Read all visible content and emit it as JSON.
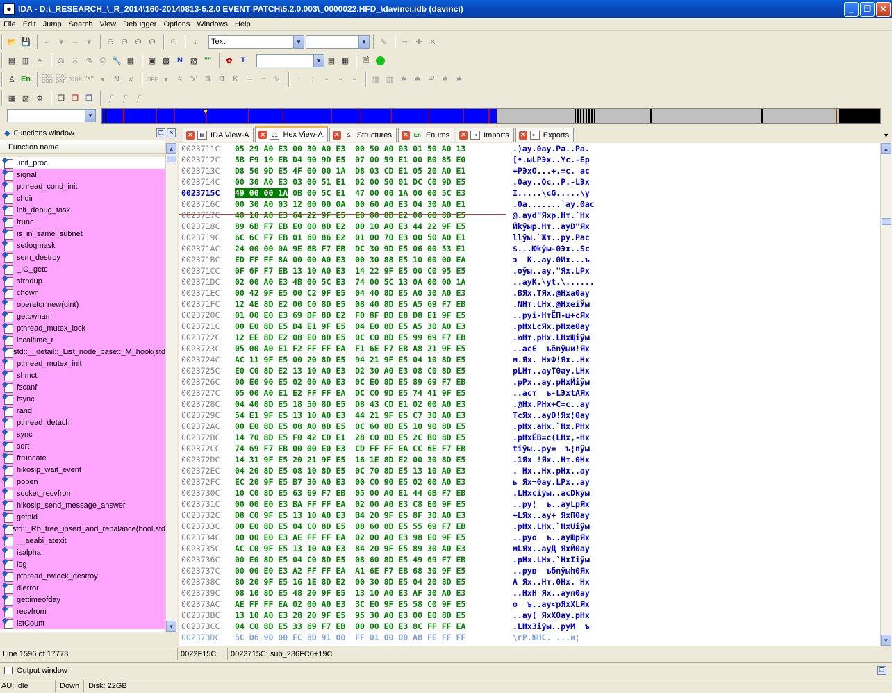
{
  "window": {
    "title": "IDA - D:\\_RESEARCH_\\_R_2014\\160-20140813-5.2.0 EVENT PATCH\\5.2.0.003\\_0000022.HFD_\\davinci.idb (davinci)"
  },
  "menu": [
    "File",
    "Edit",
    "Jump",
    "Search",
    "View",
    "Debugger",
    "Options",
    "Windows",
    "Help"
  ],
  "toolbar": {
    "type_combo": "Text",
    "second_combo": "",
    "third_combo": "",
    "nav_combo": ""
  },
  "functions_window": {
    "title": "Functions window",
    "column": "Function name",
    "items": [
      ".init_proc",
      "signal",
      "pthread_cond_init",
      "chdir",
      "init_debug_task",
      "trunc",
      "is_in_same_subnet",
      "setlogmask",
      "sem_destroy",
      "_IO_getc",
      "strndup",
      "chown",
      "operator new(uint)",
      "getpwnam",
      "pthread_mutex_lock",
      "localtime_r",
      "std::__detail::_List_node_base::_M_hook(std",
      "pthread_mutex_init",
      "shmctl",
      "fscanf",
      "fsync",
      "rand",
      "pthread_detach",
      "sync",
      "sqrt",
      "ftruncate",
      "hikosip_wait_event",
      "popen",
      "socket_recvfrom",
      "hikosip_send_message_answer",
      "getpid",
      "std::_Rb_tree_insert_and_rebalance(bool,std",
      "__aeabi_atexit",
      "isalpha",
      "log",
      "pthread_rwlock_destroy",
      "dlerror",
      "gettimeofday",
      "recvfrom",
      "lstCount"
    ]
  },
  "tabs": [
    {
      "label": "IDA View-A",
      "icon": "ida-view-icon"
    },
    {
      "label": "Hex View-A",
      "icon": "hex-view-icon",
      "active": true
    },
    {
      "label": "Structures",
      "icon": "structures-icon"
    },
    {
      "label": "Enums",
      "icon": "enums-icon",
      "prefix": "En"
    },
    {
      "label": "Imports",
      "icon": "imports-icon"
    },
    {
      "label": "Exports",
      "icon": "exports-icon"
    }
  ],
  "hex": {
    "rows": [
      {
        "addr": "0023711C",
        "hex": "05 29 A0 E3 00 30 A0 E3  00 50 A0 03 01 50 A0 13",
        "asc": ".)ay.0ay.Pa..Pa."
      },
      {
        "addr": "0023712C",
        "hex": "5B F9 19 EB D4 90 9D E5  07 00 59 E1 00 B0 85 E0",
        "asc": "[•.ыLPЭх..Yc.-Ер"
      },
      {
        "addr": "0023713C",
        "hex": "D8 50 9D E5 4F 00 00 1A  D8 03 CD E1 05 20 A0 E1",
        "asc": "+PЭхO...+.=c. ac"
      },
      {
        "addr": "0023714C",
        "hex": "00 30 A0 E3 03 00 51 E1  02 00 50 01 DC C0 9D E5",
        "asc": ".0ay..Qc..P.-LЭх"
      },
      {
        "addr": "0023715C",
        "hex": "49 00 00 1A 0B 00 5C E1  47 00 00 1A 00 00 5C E3",
        "asc": "I.....\\cG.....\\y",
        "current": true,
        "hl": "49 00 00 1A",
        "rest": " 0B 00 5C E1  47 00 00 1A 00 00 5C E3"
      },
      {
        "addr": "0023716C",
        "hex": "00 30 A0 03 12 00 00 0A  00 60 A0 E3 04 30 A0 E1",
        "asc": ".0a.......`ay.0ac"
      },
      {
        "addr": "0023717C",
        "hex": "40 10 A0 E3 64 22 9F E5  E0 00 8D E2 00 60 8D E5",
        "asc": "@.ayd\"Яхр.Нт.`Нх"
      },
      {
        "addr": "0023718C",
        "hex": "89 6B F7 EB E0 00 8D E2  00 10 A0 E3 44 22 9F E5",
        "asc": "Йkўыр.Нт..ayD\"Ях"
      },
      {
        "addr": "0023719C",
        "hex": "6C 6C F7 EB 01 60 86 E2  01 00 70 E3 00 50 A0 E1",
        "asc": "llўы.`Жт..py.Pac"
      },
      {
        "addr": "002371AC",
        "hex": "24 00 00 0A 9E 6B F7 EB  DC 30 9D E5 06 00 53 E1",
        "asc": "$...Юkўы-0Эх..Sc"
      },
      {
        "addr": "002371BC",
        "hex": "ED FF FF 8A 00 00 A0 E3  00 30 88 E5 10 00 00 EA",
        "asc": "э  К..ay.0Их...ъ"
      },
      {
        "addr": "002371CC",
        "hex": "0F 6F F7 EB 13 10 A0 E3  14 22 9F E5 00 C0 95 E5",
        "asc": ".oўы..ay.\"Ях.LРх"
      },
      {
        "addr": "002371DC",
        "hex": "02 00 A0 E3 4B 00 5C E3  74 00 5C 13 0A 00 00 1A",
        "asc": "..ayK.\\yt.\\......"
      },
      {
        "addr": "002371EC",
        "hex": "00 42 9F E5 00 C2 9F E5  04 40 8D E5 A0 30 A0 E3",
        "asc": ".BЯх.TЯх.@Нха0ay"
      },
      {
        "addr": "002371FC",
        "hex": "12 4E 8D E2 00 C0 8D E5  08 40 8D E5 A5 69 F7 EB",
        "asc": ".NНт.LНх.@НхеiЎы"
      },
      {
        "addr": "0023720C",
        "hex": "01 00 E0 E3 69 DF 8D E2  F0 8F BD E8 D8 E1 9F E5",
        "asc": "..pyi-НтЁП-ш+сЯх"
      },
      {
        "addr": "0023721C",
        "hex": "00 E0 8D E5 D4 E1 9F E5  04 E0 8D E5 A5 30 A0 E3",
        "asc": ".pНхLсЯх.pНхе0ay"
      },
      {
        "addr": "0023722C",
        "hex": "12 EE 8D E2 08 E0 8D E5  0C C0 8D E5 99 69 F7 EB",
        "asc": ".юНт.pНх.LНхЩiўы"
      },
      {
        "addr": "0023723C",
        "hex": "05 00 A0 E1 F2 FF FF EA  F1 6E F7 EB A8 21 9F E5",
        "asc": "..acЄ  ъёnўыи!Ях"
      },
      {
        "addr": "0023724C",
        "hex": "AC 11 9F E5 00 20 8D E5  94 21 9F E5 04 10 8D E5",
        "asc": "м.Ях. НхФ!Ях..Нх"
      },
      {
        "addr": "0023725C",
        "hex": "E0 C0 8D E2 13 10 A0 E3  D2 30 A0 E3 08 C0 8D E5",
        "asc": "pLНт..ayT0ay.LНх"
      },
      {
        "addr": "0023726C",
        "hex": "00 E0 90 E5 02 00 A0 E3  0C E0 8D E5 89 69 F7 EB",
        "asc": ".pРх..ay.pНхЙiўы"
      },
      {
        "addr": "0023727C",
        "hex": "05 00 A0 E1 E2 FF FF EA  DC C0 9D E5 74 41 9F E5",
        "asc": "..acт  ъ-LЭхtAЯх"
      },
      {
        "addr": "0023728C",
        "hex": "04 40 8D E5 18 50 8D E5  D8 43 CD E1 02 00 A0 E3",
        "asc": ".@Нх.PНх+C=c..ay"
      },
      {
        "addr": "0023729C",
        "hex": "54 E1 9F E5 13 10 A0 E3  44 21 9F E5 C7 30 A0 E3",
        "asc": "TсЯх..ayD!Ях¦0ay"
      },
      {
        "addr": "002372AC",
        "hex": "00 E0 8D E5 08 A0 8D E5  0C 60 8D E5 10 90 8D E5",
        "asc": ".pНх.аНх.`Нх.РНх"
      },
      {
        "addr": "002372BC",
        "hex": "14 70 8D E5 F0 42 CD E1  28 C0 8D E5 2C B0 8D E5",
        "asc": ".pНхЁB=c(LНх,-Нх"
      },
      {
        "addr": "002372CC",
        "hex": "74 69 F7 EB 00 00 E0 E3  CD FF FF EA CC 6E F7 EB",
        "asc": "tiўы..py=  ъ¦nўы"
      },
      {
        "addr": "002372DC",
        "hex": "14 31 9F E5 20 21 9F E5  16 1E 8D E2 00 30 8D E5",
        "asc": ".1Ях !Ях..Нт.0Нх"
      },
      {
        "addr": "002372EC",
        "hex": "04 20 8D E5 08 10 8D E5  0C 70 8D E5 13 10 A0 E3",
        "asc": ". Нх..Нх.pНх..ay"
      },
      {
        "addr": "002372FC",
        "hex": "EC 20 9F E5 B7 30 A0 E3  00 C0 90 E5 02 00 A0 E3",
        "asc": "ь Ях¬0ay.LРх..ay"
      },
      {
        "addr": "0023730C",
        "hex": "10 C0 8D E5 63 69 F7 EB  05 00 A0 E1 44 6B F7 EB",
        "asc": ".LНхciўы..acDkўы"
      },
      {
        "addr": "0023731C",
        "hex": "00 00 E0 E3 BA FF FF EA  02 00 A0 E3 C8 E0 9F E5",
        "asc": "..py¦  ъ..ayLpЯх"
      },
      {
        "addr": "0023732C",
        "hex": "D8 C0 9F E5 13 10 A0 E3  B4 20 9F E5 8F 30 A0 E3",
        "asc": "+LЯх..ay+ ЯхП0ay"
      },
      {
        "addr": "0023733C",
        "hex": "00 E0 8D E5 04 C0 8D E5  08 60 8D E5 55 69 F7 EB",
        "asc": ".pНх.LНх.`НхUiўы"
      },
      {
        "addr": "0023734C",
        "hex": "00 00 E0 E3 AE FF FF EA  02 00 A0 E3 98 E0 9F E5",
        "asc": "..pyо  ъ..ayШpЯх"
      },
      {
        "addr": "0023735C",
        "hex": "AC C0 9F E5 13 10 A0 E3  84 20 9F E5 89 30 A0 E3",
        "asc": "мLЯх..ayД ЯхЙ0ay"
      },
      {
        "addr": "0023736C",
        "hex": "00 E0 8D E5 04 C0 8D E5  08 60 8D E5 49 69 F7 EB",
        "asc": ".pНх.LНх.`НхIiўы"
      },
      {
        "addr": "0023737C",
        "hex": "00 00 E0 E3 A2 FF FF EA  A1 6E F7 EB 68 30 9F E5",
        "asc": "..pyв  ъбnўыh0Ях"
      },
      {
        "addr": "0023738C",
        "hex": "80 20 9F E5 16 1E 8D E2  00 30 8D E5 04 20 8D E5",
        "asc": "А Ях..Нт.0Нх. Нх"
      },
      {
        "addr": "0023739C",
        "hex": "08 10 8D E5 48 20 9F E5  13 10 A0 E3 AF 30 A0 E3",
        "asc": "..НхH Ях..ayп0ay"
      },
      {
        "addr": "002373AC",
        "hex": "AE FF FF EA 02 00 A0 E3  3C E0 9F E5 58 C0 9F E5",
        "asc": "о  ъ..ay<pЯхXLЯх"
      },
      {
        "addr": "002373BC",
        "hex": "13 10 A0 E3 28 20 9F E5  95 30 A0 E3 00 E0 8D E5",
        "asc": "..ay( ЯхХ0ay.pНх"
      },
      {
        "addr": "002373CC",
        "hex": "04 C0 8D E5 33 69 F7 EB  00 00 E0 E3 8C FF FF EA",
        "asc": ".LНх3iўы..pyМ  ъ"
      },
      {
        "addr": "002373DC",
        "hex": "5C D6 90 00 FC 8D 91 00  FF 01 00 00 A8 FE FF FF",
        "asc": "\\гР.№НС. ...и¦",
        "last": true
      }
    ]
  },
  "status": {
    "line": "Line 1596 of 17773",
    "offset": "0022F15C",
    "location": "0023715C: sub_236FC0+19C"
  },
  "output_window": {
    "title": "Output window"
  },
  "bottom": {
    "au": "AU:  idle",
    "direction": "Down",
    "disk": "Disk: 22GB"
  },
  "colors": {
    "function_bg": "#ffa5ff",
    "hex_green": "#008000",
    "ascii_blue": "#0000c8",
    "nav_blue": "#0000ff"
  }
}
